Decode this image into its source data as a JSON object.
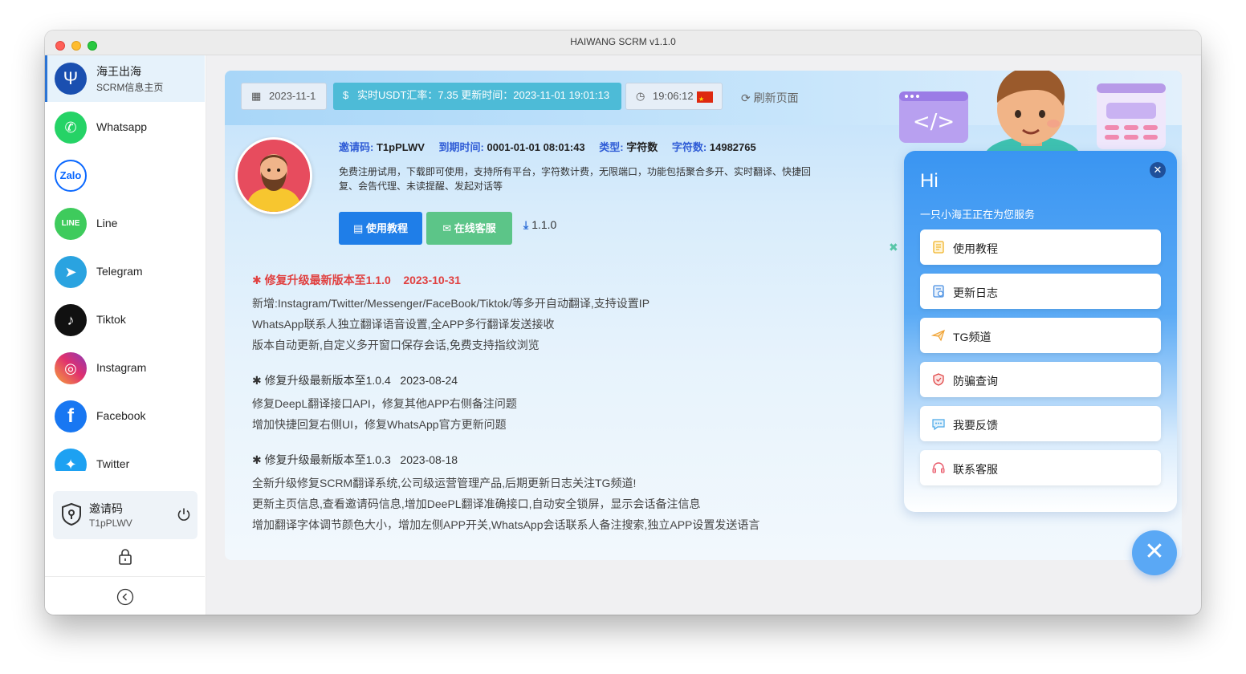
{
  "window": {
    "title": "HAIWANG SCRM v1.1.0"
  },
  "sidebar": {
    "brand": {
      "title": "海王出海",
      "subtitle": "SCRM信息主页"
    },
    "items": [
      {
        "label": "Whatsapp",
        "icon": "whatsapp-icon",
        "color": "#25d366"
      },
      {
        "label": "",
        "icon": "zalo-icon",
        "color": "#0a68ff"
      },
      {
        "label": "Line",
        "icon": "line-icon",
        "color": "#3ecb5c"
      },
      {
        "label": "Telegram",
        "icon": "telegram-icon",
        "color": "#2aa3e0"
      },
      {
        "label": "Tiktok",
        "icon": "tiktok-icon",
        "color": "#111111"
      },
      {
        "label": "Instagram",
        "icon": "instagram-icon",
        "color": "#d9317a"
      },
      {
        "label": "Facebook",
        "icon": "facebook-icon",
        "color": "#1877f2"
      },
      {
        "label": "Twitter",
        "icon": "twitter-icon",
        "color": "#1da1f2"
      }
    ],
    "invite": {
      "label": "邀请码",
      "code": "T1pPLWV"
    }
  },
  "topbar": {
    "date": "2023-11-1",
    "rate": "实时USDT汇率：7.35 更新时间：2023-11-01 19:01:13",
    "clock": "19:06:12",
    "refresh": "刷新页面"
  },
  "profile": {
    "invite_key": "邀请码:",
    "invite_val": "T1pPLWV",
    "expire_key": "到期时间:",
    "expire_val": "0001-01-01 08:01:43",
    "type_key": "类型:",
    "type_val": "字符数",
    "count_key": "字符数:",
    "count_val": "14982765",
    "description": "免费注册试用，下载即可使用，支持所有平台，字符数计费，无限端口，功能包括聚合多开、实时翻译、快捷回复、会告代理、未读提醒、发起对话等",
    "tutorial_button": "使用教程",
    "support_button": "在线客服",
    "version": "1.1.0"
  },
  "changelog": [
    {
      "title": "修复升级最新版本至1.1.0    2023-10-31",
      "lines": [
        "新增:Instagram/Twitter/Messenger/FaceBook/Tiktok/等多开自动翻译,支持设置IP",
        "WhatsApp联系人独立翻译语音设置,全APP多行翻译发送接收",
        "版本自动更新,自定义多开窗口保存会话,免费支持指纹浏览"
      ]
    },
    {
      "title": "修复升级最新版本至1.0.4   2023-08-24",
      "lines": [
        "修复DeepL翻译接口API，修复其他APP右侧备注问题",
        "增加快捷回复右侧UI，修复WhatsApp官方更新问题"
      ]
    },
    {
      "title": "修复升级最新版本至1.0.3   2023-08-18",
      "lines": [
        "全新升级修复SCRM翻译系统,公司级运营管理产品,后期更新日志关注TG频道!",
        "更新主页信息,查看邀请码信息,增加DeePL翻译准确接口,自动安全锁屏，显示会话备注信息",
        "增加翻译字体调节颜色大小，增加左侧APP开关,WhatsApp会话联系人备注搜索,独立APP设置发送语言"
      ]
    }
  ],
  "chat": {
    "greeting": "Hi",
    "subtitle": "一只小海王正在为您服务",
    "items": [
      {
        "label": "使用教程",
        "icon": "document-icon",
        "color": "#f0b429"
      },
      {
        "label": "更新日志",
        "icon": "log-icon",
        "color": "#4a90e2"
      },
      {
        "label": "TG频道",
        "icon": "paper-plane-icon",
        "color": "#f0a030"
      },
      {
        "label": "防骗查询",
        "icon": "shield-icon",
        "color": "#e04848"
      },
      {
        "label": "我要反馈",
        "icon": "chat-bubble-icon",
        "color": "#4aa8e8"
      },
      {
        "label": "联系客服",
        "icon": "headset-icon",
        "color": "#e85a6a"
      }
    ]
  }
}
